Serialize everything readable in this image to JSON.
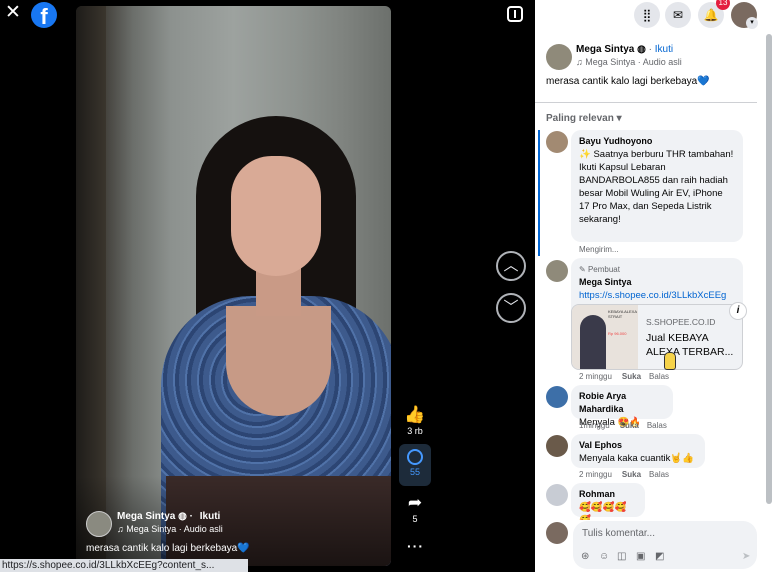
{
  "viewer": {
    "logo_letter": "f",
    "video": {
      "author_name": "Mega Sintya",
      "follow_label": "Ikuti",
      "audio": "♫ Mega Sintya · Audio asli",
      "caption": "merasa cantik kalo lagi berkebaya💙"
    },
    "actions": {
      "like_count": "3 rb",
      "comment_count": "55",
      "share_count": "5",
      "more_label": "···"
    },
    "status_url": "https://s.shopee.co.id/3LLkbXcEEg?content_s..."
  },
  "panel": {
    "topbar": {
      "notification_count": "13"
    },
    "post": {
      "author_name": "Mega Sintya",
      "follow_label": "Ikuti",
      "audio": "♫ Mega Sintya · Audio asli",
      "caption": "merasa cantik kalo lagi berkebaya💙"
    },
    "sort_label": "Paling relevan",
    "comments": [
      {
        "author": "Bayu Yudhoyono",
        "text": "✨ Saatnya berburu THR tambahan! Ikuti Kapsul Lebaran BANDARBOLA855 dan raih hadiah besar Mobil Wuling Air EV, iPhone 17 Pro Max, dan Sepeda Listrik sekarang!",
        "meta": "Mengirim..."
      },
      {
        "badge": "Pembuat",
        "author": "Mega Sintya",
        "link": "https://s.shopee.co.id/3LLkbXcEEg",
        "preview": {
          "domain": "S.SHOPEE.CO.ID",
          "title": "Jual KEBAYA ALEXA TERBAR...",
          "thumb_text": "KEBAYA ALEXA STRAIT",
          "thumb_price": "Rp 96.000"
        },
        "time": "2 minggu",
        "like": "Suka",
        "reply": "Balas"
      },
      {
        "author": "Robie Arya Mahardika",
        "text": "Menyala 😍🔥",
        "time": "1minggu",
        "like": "Suka",
        "reply": "Balas"
      },
      {
        "author": "Val Ephos",
        "text": "Menyala kaka cuantik🤘👍",
        "time": "2 minggu",
        "like": "Suka",
        "reply": "Balas"
      },
      {
        "author": "Rohman",
        "text": "🥰🥰🥰🥰🥰"
      }
    ],
    "composer": {
      "placeholder": "Tulis komentar..."
    }
  },
  "colors": {
    "facebook_blue": "#1877f2",
    "link_blue": "#0064d1",
    "badge_red": "#e41e3f",
    "bubble_bg": "#f0f2f5"
  }
}
